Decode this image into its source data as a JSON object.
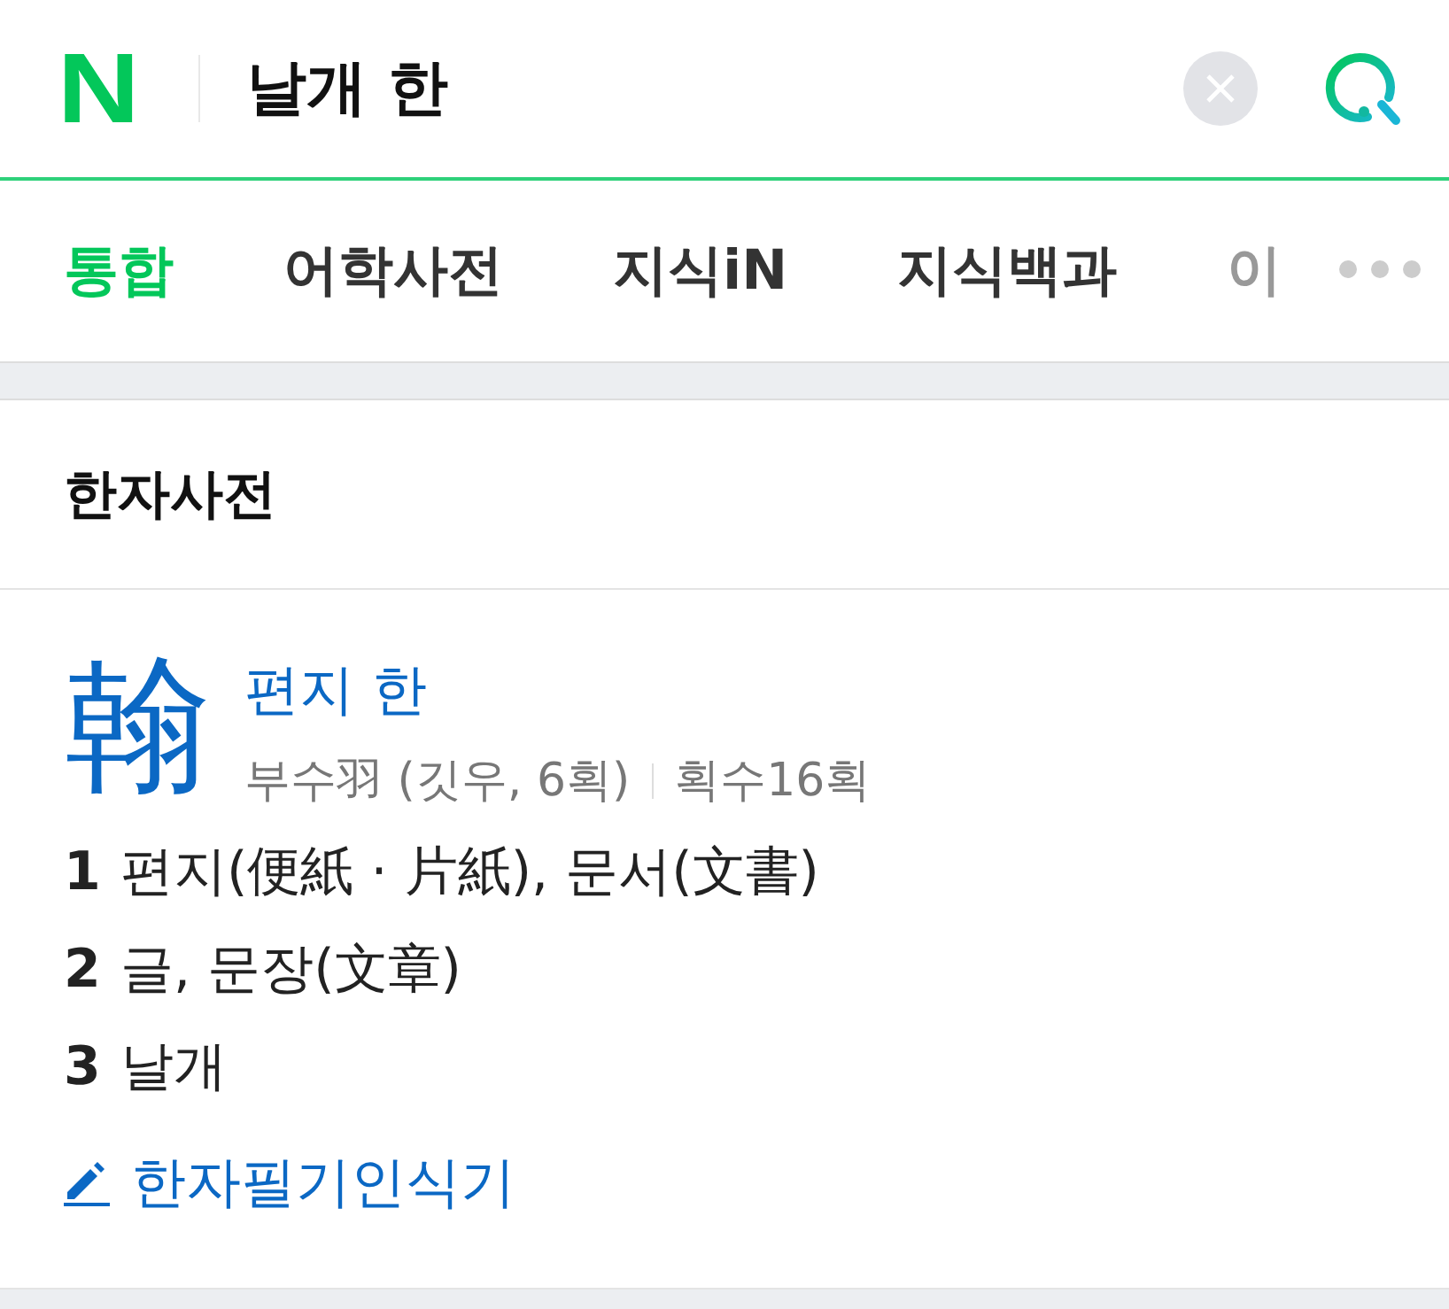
{
  "header": {
    "logo": "N",
    "query": "날개 한"
  },
  "tabs": [
    {
      "label": "통합",
      "selected": true
    },
    {
      "label": "어학사전",
      "selected": false
    },
    {
      "label": "지식iN",
      "selected": false
    },
    {
      "label": "지식백과",
      "selected": false
    },
    {
      "label": "이",
      "selected": false
    }
  ],
  "section": {
    "title": "한자사전"
  },
  "entry": {
    "character": "翰",
    "reading": "편지 한",
    "radical": "부수羽 (깃우, 6획)",
    "strokes": "획수16획",
    "meanings": [
      {
        "number": "1",
        "text": "편지(便紙 · 片紙), 문서(文書)"
      },
      {
        "number": "2",
        "text": "글, 문장(文章)"
      },
      {
        "number": "3",
        "text": "날개"
      }
    ],
    "link": "한자필기인식기"
  }
}
